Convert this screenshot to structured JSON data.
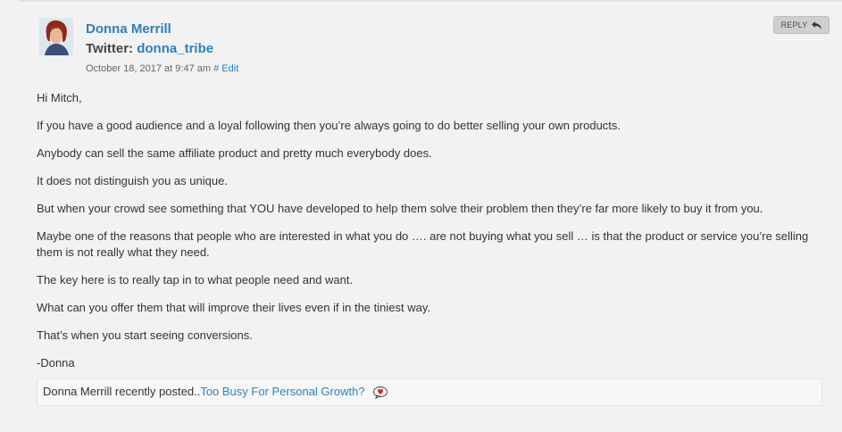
{
  "comment": {
    "author": {
      "name": "Donna Merrill",
      "twitter_label": "Twitter:",
      "twitter_handle": "donna_tribe"
    },
    "meta": {
      "timestamp": "October 18, 2017 at 9:47 am",
      "permalink_label": "#",
      "edit_label": "Edit"
    },
    "reply_button": {
      "label": "REPLY",
      "icon": "reply-arrow-icon"
    },
    "paragraphs": [
      "Hi Mitch,",
      "If you have a good audience and a loyal following then you’re always going to do better selling your own products.",
      "Anybody can sell the same affiliate product and pretty much everybody does.",
      "It does not distinguish you as unique.",
      "But when your crowd see something that YOU have developed to help them solve their problem then they’re far more likely to buy it from you.",
      "Maybe one of the reasons that people who are interested in what you do …. are not buying what you sell … is that the product or service you’re selling them is not really what they need.",
      "The key here is to really tap in to what people need and want.",
      "What can you offer them that will improve their lives even if in the tiniest way.",
      "That’s when you start seeing conversions.",
      "-Donna"
    ],
    "recently_posted": {
      "prefix": "Donna Merrill recently posted..",
      "link_text": "Too Busy For Personal Growth?",
      "icon": "commentluv-heart-icon"
    }
  },
  "colors": {
    "background": "#f2f2f2",
    "link": "#2f7fbd",
    "text": "#333333",
    "reply_button": "#cfcfcf"
  }
}
